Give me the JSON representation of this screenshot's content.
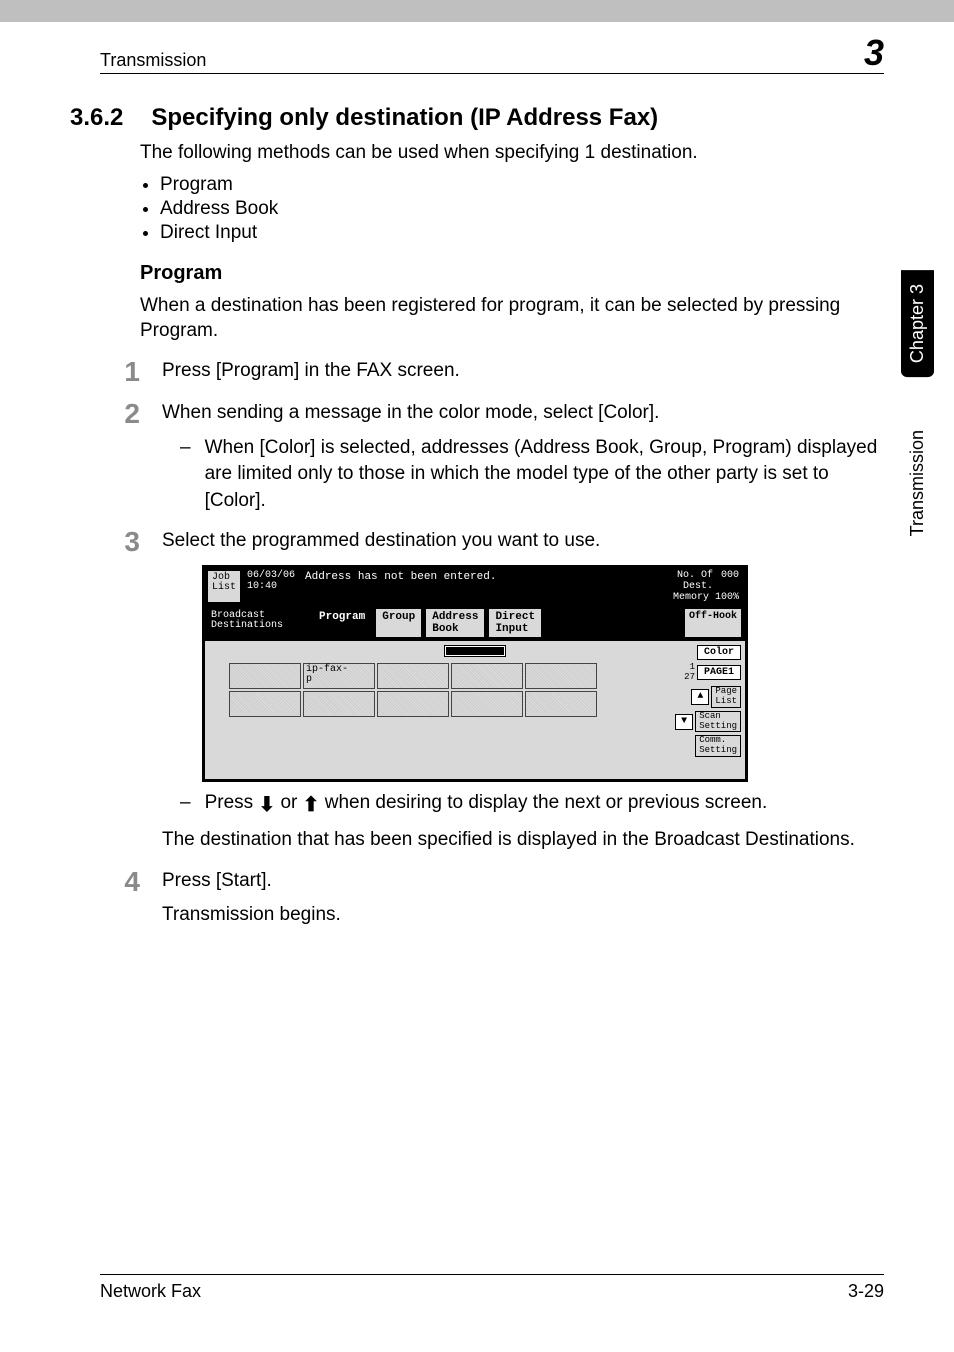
{
  "header": {
    "left": "Transmission",
    "right": "3"
  },
  "side": {
    "chapter": "Chapter 3",
    "section": "Transmission"
  },
  "footer": {
    "left": "Network Fax",
    "right": "3-29"
  },
  "sec_num": "3.6.2",
  "sec_title": "Specifying only destination (IP Address Fax)",
  "intro": "The following methods can be used when specifying 1 destination.",
  "methods": [
    "Program",
    "Address Book",
    "Direct Input"
  ],
  "sub_head": "Program",
  "prog_intro": "When a destination has been registered for program, it can be selected by pressing Program.",
  "steps": {
    "s1": "Press [Program] in the FAX screen.",
    "s2": "When sending a message in the color mode, select [Color].",
    "s2a": "When [Color] is selected, addresses (Address Book, Group, Program) displayed are limited only to those in which the model type of the other party is set to [Color].",
    "s3": "Select the programmed destination you want to use.",
    "s3a_pre": "Press",
    "s3a_mid": "or",
    "s3a_post": "when desiring to display the next or previous screen.",
    "s3b": "The destination that has been specified is displayed in the Broadcast Destinations.",
    "s4": "Press [Start].",
    "s4b": "Transmission begins."
  },
  "fax": {
    "job_list": "Job\nList",
    "datetime": "06/03/06\n10:40",
    "msg": "Address has not been entered.",
    "no_of_dest_label": "No. Of\nDest.",
    "no_of_dest_val": "000",
    "memory": "Memory 100%",
    "bc_dest": "Broadcast\nDestinations",
    "tabs": {
      "program": "Program",
      "group": "Group",
      "addrbook": "Address\nBook",
      "direct": "Direct\nInput"
    },
    "offhook": "Off-Hook",
    "program_cell": "ip-fax-\np",
    "page_count": "1\n27",
    "right": {
      "color": "Color",
      "page1": "PAGE1",
      "pagelist": "Page\nList",
      "scan": "Scan\nSetting",
      "comm": "Comm.\nSetting"
    }
  }
}
